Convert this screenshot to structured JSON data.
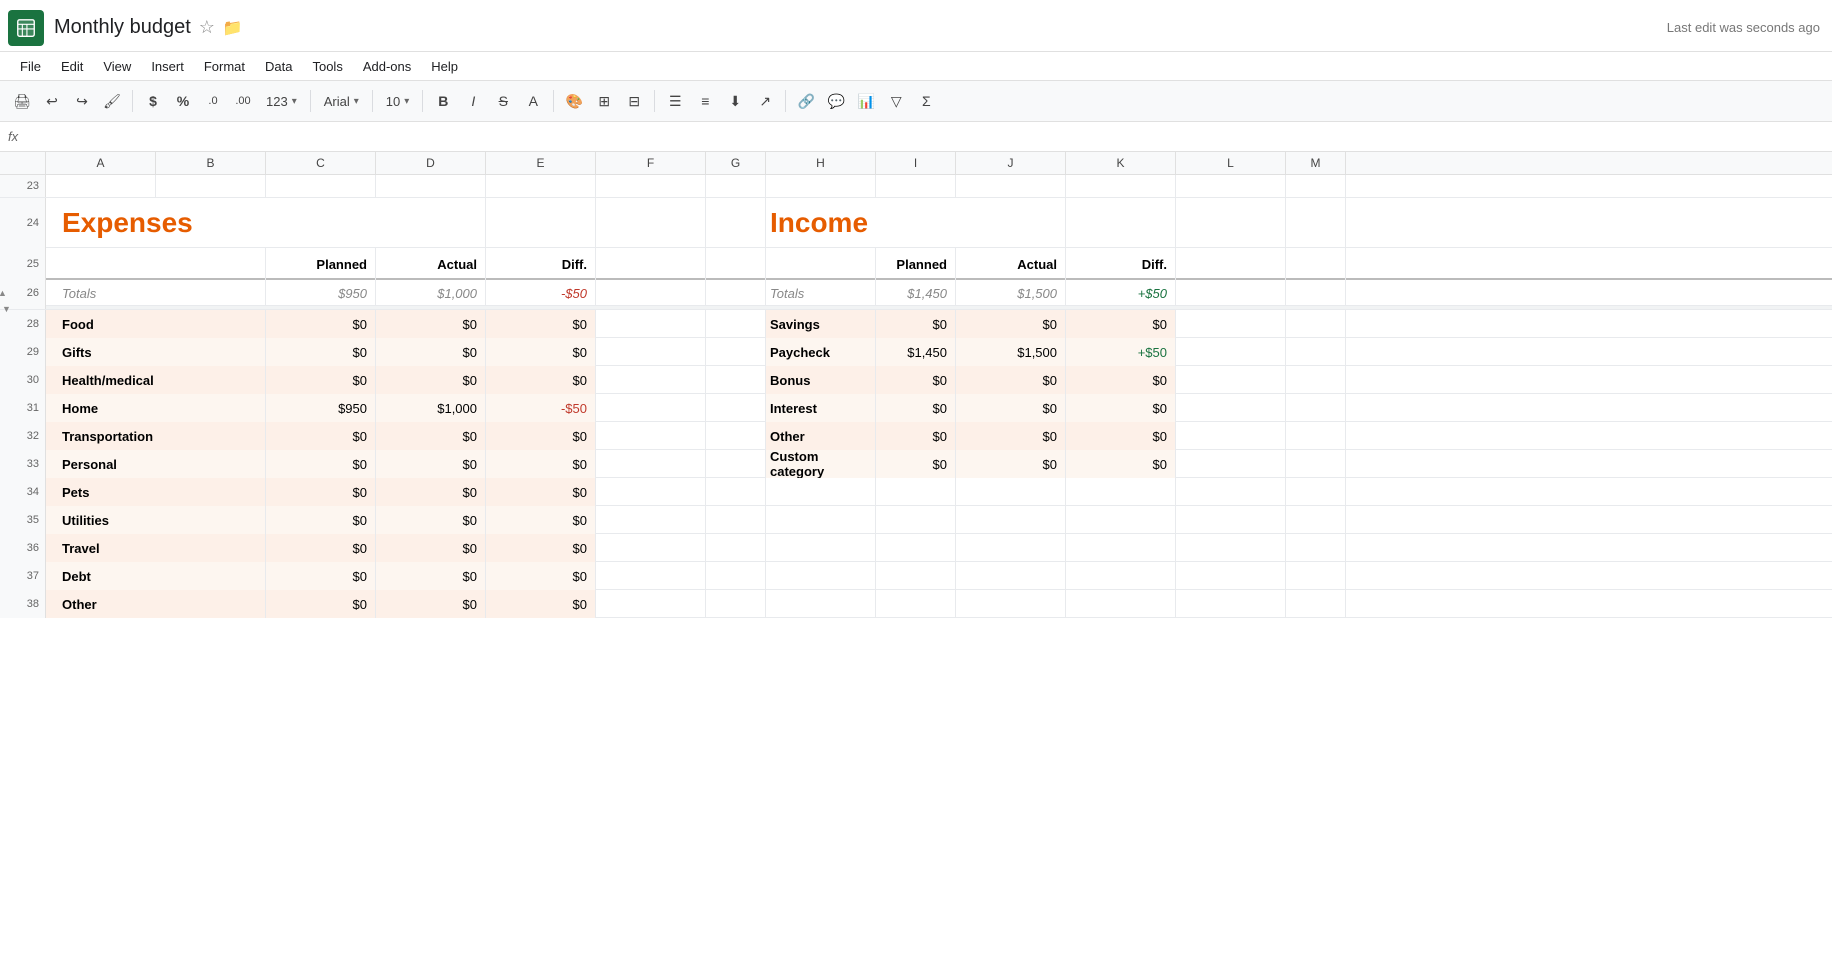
{
  "app": {
    "logo_alt": "Google Sheets",
    "title": "Monthly budget",
    "last_edit": "Last edit was seconds ago"
  },
  "menu": {
    "items": [
      "File",
      "Edit",
      "View",
      "Insert",
      "Format",
      "Data",
      "Tools",
      "Add-ons",
      "Help"
    ]
  },
  "toolbar": {
    "font": "Arial",
    "font_size": "10",
    "buttons": [
      "print",
      "undo",
      "redo",
      "paint-format",
      "dollar",
      "percent",
      "decimal-decrease",
      "decimal-increase",
      "123-format",
      "bold",
      "italic",
      "strikethrough",
      "text-color",
      "fill-color",
      "borders",
      "merge",
      "align-left",
      "align-center",
      "align-right",
      "vertical-align",
      "text-rotation",
      "link",
      "comment",
      "chart",
      "filter",
      "functions"
    ]
  },
  "formula_bar": {
    "fx_label": "fx",
    "cell_ref": ""
  },
  "columns": {
    "row_width": 46,
    "headers": [
      "A",
      "B",
      "C",
      "D",
      "E",
      "F",
      "G",
      "H",
      "I",
      "J",
      "K",
      "L",
      "M"
    ],
    "widths": [
      110,
      110,
      110,
      110,
      110,
      110,
      60,
      110,
      80,
      110,
      110,
      110,
      60
    ]
  },
  "row_numbers": [
    "23",
    "24",
    "25",
    "26",
    "28",
    "29",
    "30",
    "31",
    "32",
    "33",
    "34",
    "35",
    "36",
    "37",
    "38"
  ],
  "expenses": {
    "title": "Expenses",
    "headers": {
      "category": "",
      "planned": "Planned",
      "actual": "Actual",
      "diff": "Diff."
    },
    "totals": {
      "label": "Totals",
      "planned": "$950",
      "actual": "$1,000",
      "diff": "-$50"
    },
    "rows": [
      {
        "category": "Food",
        "planned": "$0",
        "actual": "$0",
        "diff": "$0"
      },
      {
        "category": "Gifts",
        "planned": "$0",
        "actual": "$0",
        "diff": "$0"
      },
      {
        "category": "Health/medical",
        "planned": "$0",
        "actual": "$0",
        "diff": "$0"
      },
      {
        "category": "Home",
        "planned": "$950",
        "actual": "$1,000",
        "diff": "-$50"
      },
      {
        "category": "Transportation",
        "planned": "$0",
        "actual": "$0",
        "diff": "$0"
      },
      {
        "category": "Personal",
        "planned": "$0",
        "actual": "$0",
        "diff": "$0"
      },
      {
        "category": "Pets",
        "planned": "$0",
        "actual": "$0",
        "diff": "$0"
      },
      {
        "category": "Utilities",
        "planned": "$0",
        "actual": "$0",
        "diff": "$0"
      },
      {
        "category": "Travel",
        "planned": "$0",
        "actual": "$0",
        "diff": "$0"
      },
      {
        "category": "Debt",
        "planned": "$0",
        "actual": "$0",
        "diff": "$0"
      },
      {
        "category": "Other",
        "planned": "$0",
        "actual": "$0",
        "diff": "$0"
      }
    ]
  },
  "income": {
    "title": "Income",
    "headers": {
      "category": "",
      "planned": "Planned",
      "actual": "Actual",
      "diff": "Diff."
    },
    "totals": {
      "label": "Totals",
      "planned": "$1,450",
      "actual": "$1,500",
      "diff": "+$50"
    },
    "rows": [
      {
        "category": "Savings",
        "planned": "$0",
        "actual": "$0",
        "diff": "$0"
      },
      {
        "category": "Paycheck",
        "planned": "$1,450",
        "actual": "$1,500",
        "diff": "+$50"
      },
      {
        "category": "Bonus",
        "planned": "$0",
        "actual": "$0",
        "diff": "$0"
      },
      {
        "category": "Interest",
        "planned": "$0",
        "actual": "$0",
        "diff": "$0"
      },
      {
        "category": "Other",
        "planned": "$0",
        "actual": "$0",
        "diff": "$0"
      },
      {
        "category": "Custom category",
        "planned": "$0",
        "actual": "$0",
        "diff": "$0"
      }
    ]
  }
}
